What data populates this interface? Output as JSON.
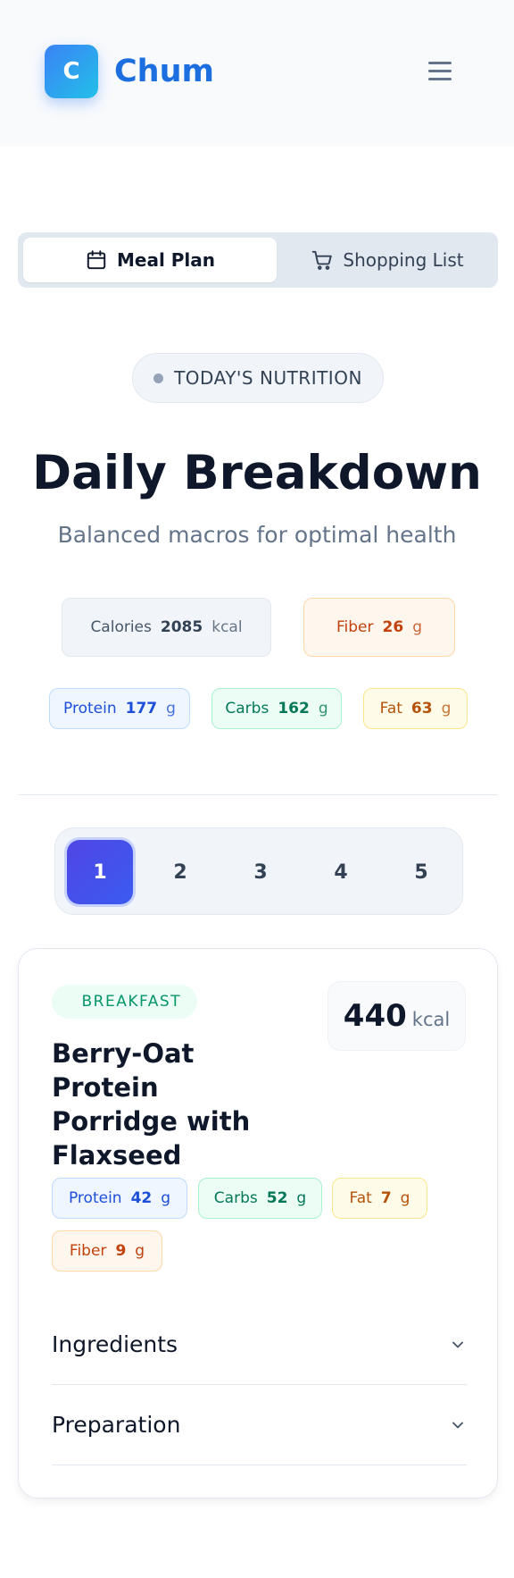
{
  "header": {
    "logo_letter": "C",
    "app_name": "Chum"
  },
  "tabs": [
    {
      "label": "Meal Plan",
      "icon": "calendar-icon",
      "active": true
    },
    {
      "label": "Shopping List",
      "icon": "cart-icon",
      "active": false
    }
  ],
  "nutrition": {
    "badge": "TODAY'S NUTRITION",
    "title": "Daily Breakdown",
    "subtitle": "Balanced macros for optimal health",
    "calories": {
      "label": "Calories",
      "value": "2085",
      "unit": "kcal"
    },
    "fiber": {
      "label": "Fiber",
      "value": "26",
      "unit": "g"
    },
    "protein": {
      "label": "Protein",
      "value": "177",
      "unit": "g"
    },
    "carbs": {
      "label": "Carbs",
      "value": "162",
      "unit": "g"
    },
    "fat": {
      "label": "Fat",
      "value": "63",
      "unit": "g"
    }
  },
  "pager": {
    "pages": [
      "1",
      "2",
      "3",
      "4",
      "5"
    ],
    "active": "1"
  },
  "meal": {
    "type": "BREAKFAST",
    "name": "Berry-Oat Protein Porridge with Flaxseed",
    "calories": "440",
    "calories_unit": "kcal",
    "protein": {
      "label": "Protein",
      "value": "42",
      "unit": "g"
    },
    "carbs": {
      "label": "Carbs",
      "value": "52",
      "unit": "g"
    },
    "fat": {
      "label": "Fat",
      "value": "7",
      "unit": "g"
    },
    "fiber": {
      "label": "Fiber",
      "value": "9",
      "unit": "g"
    },
    "sections": [
      {
        "label": "Ingredients",
        "icon": "chevron-down-icon"
      },
      {
        "label": "Preparation",
        "icon": "chevron-down-icon"
      }
    ]
  },
  "colors": {
    "brand": "#1d6fe0",
    "accent_indigo": "#4f46e5",
    "protein": "#1d4ed8",
    "carbs": "#047857",
    "fat": "#b45309",
    "fiber": "#c2410c"
  }
}
